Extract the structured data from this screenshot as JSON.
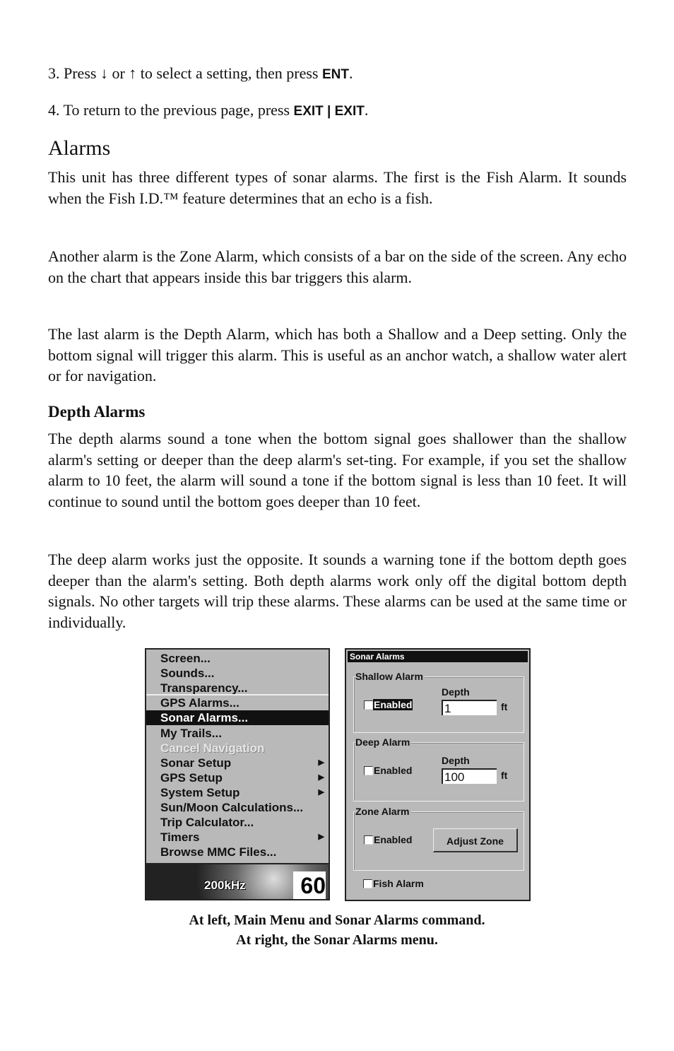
{
  "steps": [
    {
      "text": "3. Press ↓ or ↑ to select a setting, then press ",
      "key": "ENT",
      "end": "."
    },
    {
      "text": "4. To return to the previous page, press ",
      "key": "EXIT | EXIT",
      "end": "."
    }
  ],
  "heading": "Alarms",
  "paragraphs": [
    "This unit has three different types of sonar alarms. The first is the Fish Alarm. It sounds when the Fish I.D.™ feature determines that an echo is a fish.",
    "Another alarm is the Zone Alarm, which consists of a bar on the side of the screen. Any echo on the chart that appears inside this bar triggers this alarm.",
    "The last alarm is the Depth Alarm, which has both a Shallow and a Deep setting. Only the bottom signal will trigger this alarm. This is useful as an anchor watch, a shallow water alert or for navigation."
  ],
  "subheading": "Depth Alarms",
  "paragraphs2": [
    "The depth alarms sound a tone when the bottom signal goes shallower than the shallow alarm's setting or deeper than the deep alarm's set-ting. For example, if you set the shallow alarm to 10 feet, the alarm will sound a tone if the bottom signal is less than 10 feet. It will continue to sound until the bottom goes deeper than 10 feet.",
    "The deep alarm works just the opposite. It sounds a warning tone if the bottom depth goes deeper than the alarm's setting. Both depth alarms work only off the digital bottom depth signals. No other targets will trip these alarms. These alarms can be used at the same time or individually."
  ],
  "menu": {
    "items": [
      {
        "label": "Screen..."
      },
      {
        "label": "Sounds..."
      },
      {
        "label": "Transparency..."
      },
      {
        "label": "GPS Alarms..."
      },
      {
        "label": "Sonar Alarms...",
        "selected": true
      },
      {
        "label": "My Trails..."
      },
      {
        "label": "Cancel Navigation",
        "disabled": true
      },
      {
        "label": "Sonar Setup",
        "submenu": true
      },
      {
        "label": "GPS Setup",
        "submenu": true
      },
      {
        "label": "System Setup",
        "submenu": true
      },
      {
        "label": "Sun/Moon Calculations..."
      },
      {
        "label": "Trip Calculator..."
      },
      {
        "label": "Timers",
        "submenu": true
      },
      {
        "label": "Browse MMC Files..."
      }
    ],
    "frequency": "200kHz",
    "depth": "60"
  },
  "dialog": {
    "title": "Sonar Alarms",
    "shallow": {
      "label": "Shallow Alarm",
      "enabled_label": "Enabled",
      "enabled": false,
      "depth_label": "Depth",
      "depth": "1",
      "unit": "ft"
    },
    "deep": {
      "label": "Deep Alarm",
      "enabled_label": "Enabled",
      "enabled": false,
      "depth_label": "Depth",
      "depth": "100",
      "unit": "ft"
    },
    "zone": {
      "label": "Zone Alarm",
      "enabled_label": "Enabled",
      "enabled": false,
      "button": "Adjust Zone"
    },
    "fish": {
      "label": "Fish Alarm",
      "enabled": false
    }
  },
  "caption": [
    "At left, Main Menu and Sonar Alarms command.",
    "At right, the Sonar Alarms menu."
  ]
}
